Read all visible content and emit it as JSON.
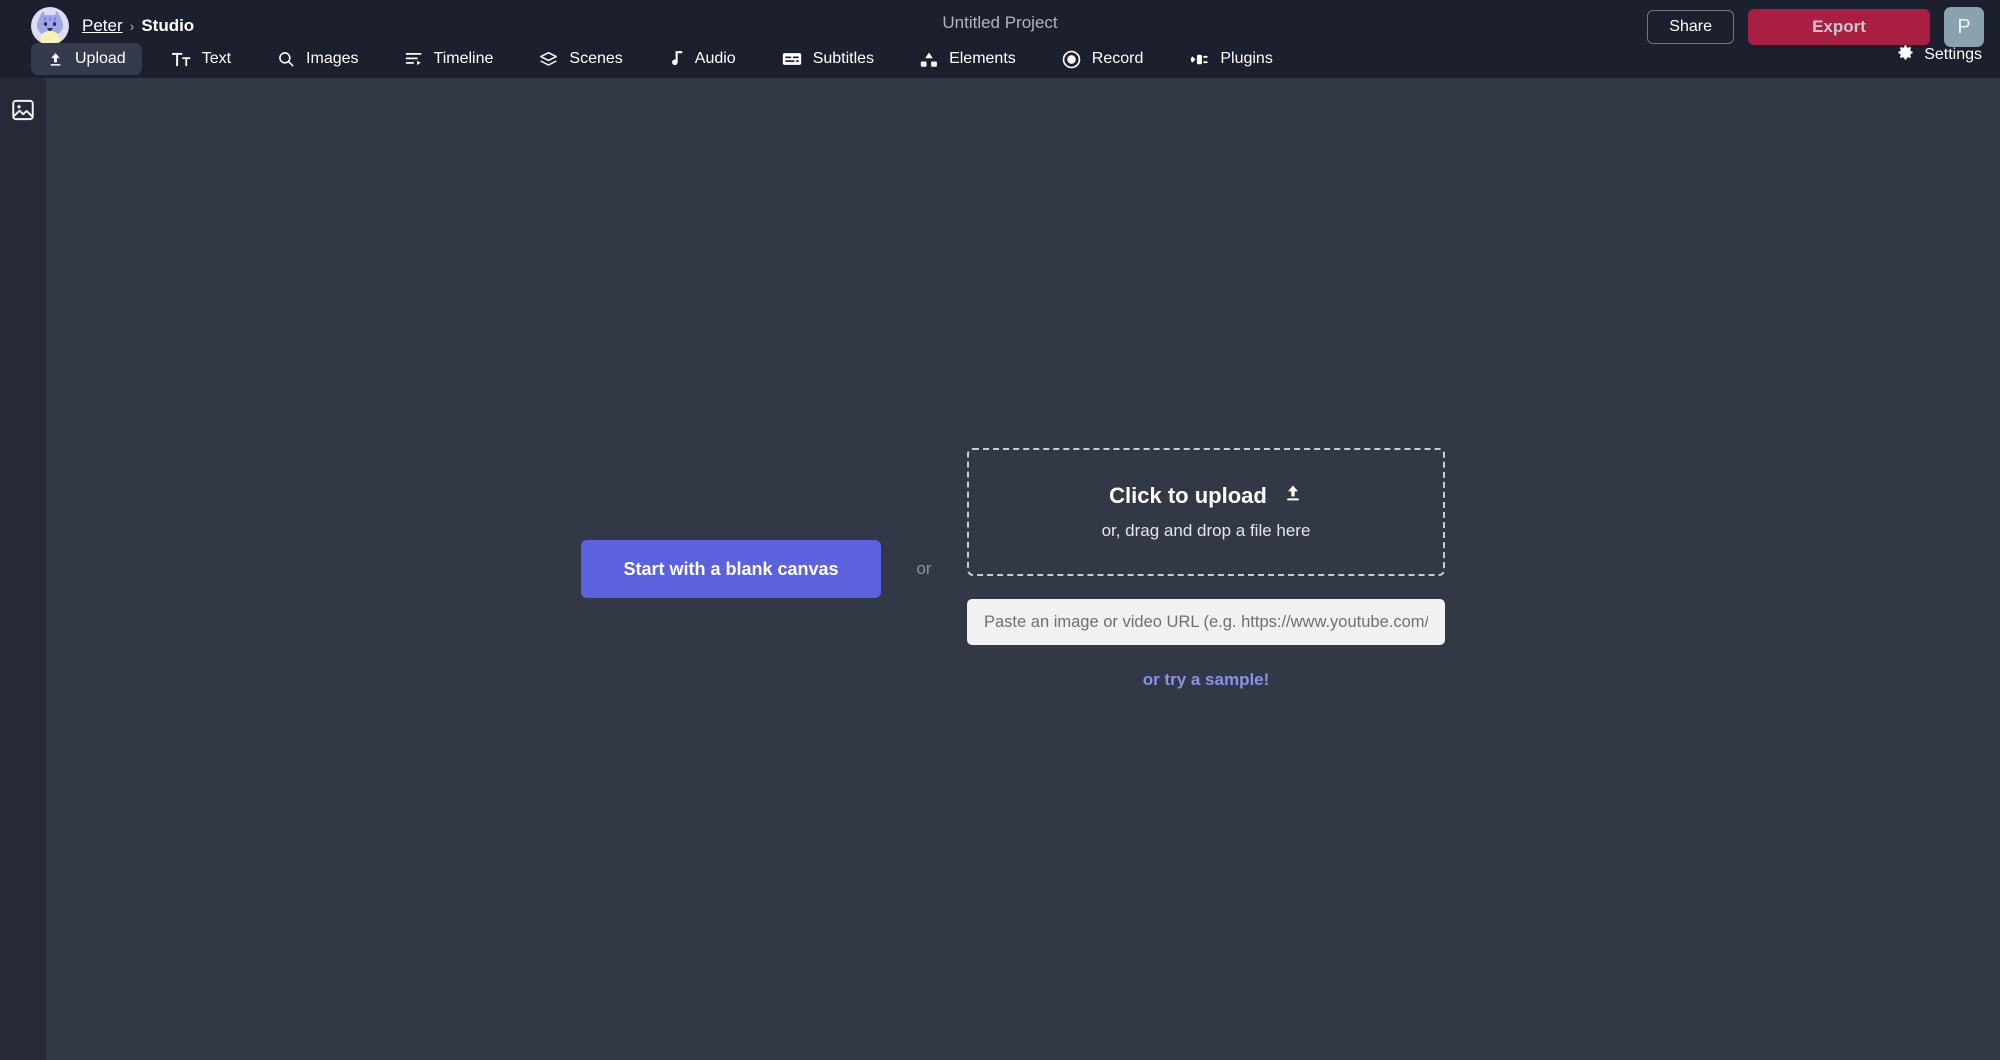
{
  "app": {
    "project_title": "Untitled Project",
    "background_canvas": "#333846",
    "background_chrome": "#1b1f2e",
    "accent_primary": "#5c62de",
    "accent_export": "#a91f43",
    "accent_link": "#8a92e8"
  },
  "breadcrumb": {
    "user": "Peter",
    "separator": "›",
    "current": "Studio"
  },
  "topbar": {
    "share_label": "Share",
    "export_label": "Export",
    "user_badge_initial": "P",
    "settings_label": "Settings",
    "settings_icon": "gear-icon",
    "avatar_icon": "cat-avatar-icon"
  },
  "tabs": [
    {
      "label": "Upload",
      "icon": "upload-icon",
      "active": true
    },
    {
      "label": "Text",
      "icon": "text-icon",
      "active": false
    },
    {
      "label": "Images",
      "icon": "search-icon",
      "active": false
    },
    {
      "label": "Timeline",
      "icon": "timeline-icon",
      "active": false
    },
    {
      "label": "Scenes",
      "icon": "layers-icon",
      "active": false
    },
    {
      "label": "Audio",
      "icon": "music-note-icon",
      "active": false
    },
    {
      "label": "Subtitles",
      "icon": "subtitles-icon",
      "active": false
    },
    {
      "label": "Elements",
      "icon": "elements-icon",
      "active": false
    },
    {
      "label": "Record",
      "icon": "record-icon",
      "active": false
    },
    {
      "label": "Plugins",
      "icon": "plug-icon",
      "active": false
    }
  ],
  "left_rail": {
    "items": [
      {
        "icon": "image-icon",
        "name": "media-panel-toggle"
      }
    ]
  },
  "main": {
    "blank_canvas_label": "Start with a blank canvas",
    "or_divider": "or",
    "dropzone": {
      "primary": "Click to upload",
      "icon": "upload-icon",
      "secondary": "or, drag and drop a file here"
    },
    "url_input": {
      "placeholder": "Paste an image or video URL (e.g. https://www.youtube.com/watch?v=...)",
      "value": ""
    },
    "sample_link": "or try a sample!"
  }
}
